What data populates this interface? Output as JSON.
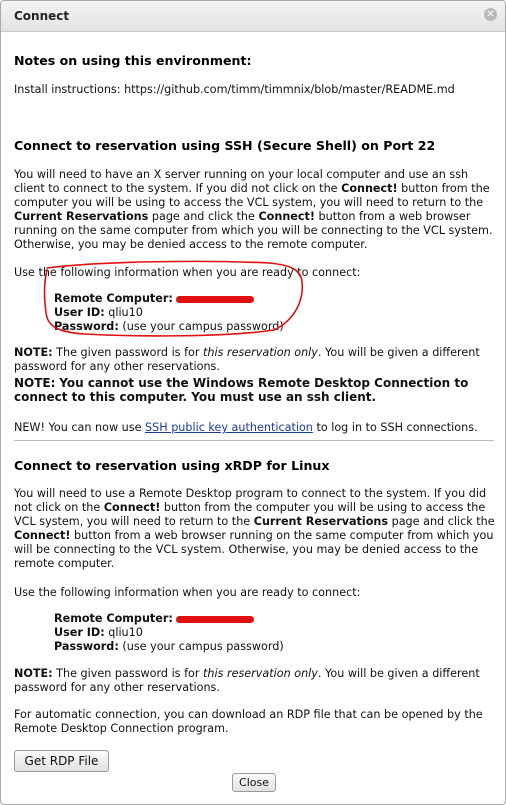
{
  "dialog": {
    "title": "Connect"
  },
  "notes": {
    "heading": "Notes on using this environment:",
    "install_text": "Install instructions: https://github.com/timm/timmnix/blob/master/README.md"
  },
  "ssh": {
    "heading": "Connect to reservation using SSH (Secure Shell) on Port 22",
    "p1_a": "You will need to have an X server running on your local computer and use an ssh client to connect to the system. If you did not click on the ",
    "connect_word": "Connect!",
    "p1_b": " button from the computer you will be using to access the VCL system, you will need to return to the ",
    "current_reservations": "Current Reservations",
    "p1_c": " page and click the ",
    "p1_d": " button from a web browser running on the same computer from which you will be connecting to the VCL system. Otherwise, you may be denied access to the remote computer.",
    "use_info": "Use the following information when you are ready to connect:",
    "remote_label": "Remote Computer:",
    "userid_label": "User ID:",
    "userid_value": "qliu10",
    "password_label": "Password:",
    "password_value": "(use your campus password)",
    "note_label": "NOTE:",
    "note_a": " The given password is for ",
    "note_em": "this reservation only",
    "note_b": ". You will be given a different password for any other reservations.",
    "note2_label": "NOTE:",
    "note2_text": "You cannot use the Windows Remote Desktop Connection to connect to this computer. You must use an ssh client.",
    "new_label": "NEW!",
    "new_a": " You can now use ",
    "new_link": "SSH public key authentication",
    "new_b": " to log in to SSH connections."
  },
  "xrdp": {
    "heading": "Connect to reservation using xRDP for Linux",
    "p1_a": "You will need to use a Remote Desktop program to connect to the system. If you did not click on the ",
    "connect_word": "Connect!",
    "p1_b": " button from the computer you will be using to access the VCL system, you will need to return to the ",
    "current_reservations": "Current Reservations",
    "p1_c": " page and click the ",
    "p1_d": " button from a web browser running on the same computer from which you will be connecting to the VCL system. Otherwise, you may be denied access to the remote computer.",
    "use_info": "Use the following information when you are ready to connect:",
    "remote_label": "Remote Computer:",
    "userid_label": "User ID:",
    "userid_value": "qliu10",
    "password_label": "Password:",
    "password_value": "(use your campus password)",
    "note_label": "NOTE:",
    "note_a": " The given password is for ",
    "note_em": "this reservation only",
    "note_b": ". You will be given a different password for any other reservations.",
    "auto_text": "For automatic connection, you can download an RDP file that can be opened by the Remote Desktop Connection program."
  },
  "buttons": {
    "get_rdp": "Get RDP File",
    "close": "Close"
  },
  "colors": {
    "redaction": "#e01010",
    "link": "#1a3d9a"
  }
}
